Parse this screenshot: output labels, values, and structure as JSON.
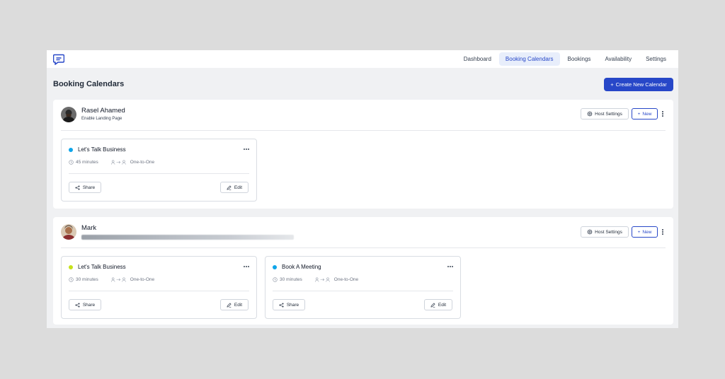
{
  "nav": {
    "items": [
      {
        "label": "Dashboard"
      },
      {
        "label": "Booking Calendars"
      },
      {
        "label": "Bookings"
      },
      {
        "label": "Availability"
      },
      {
        "label": "Settings"
      }
    ],
    "active_index": 1
  },
  "page": {
    "title": "Booking Calendars",
    "create_button": "Create New Calendar"
  },
  "hosts": [
    {
      "name": "Rasel Ahamed",
      "subtitle": "Enable Landing Page",
      "host_settings_label": "Host Settings",
      "new_label": "New",
      "events": [
        {
          "title": "Let's Talk Business",
          "duration": "45 minutes",
          "type": "One-to-One",
          "dot_color": "#0ea5e9",
          "share_label": "Share",
          "edit_label": "Edit"
        }
      ]
    },
    {
      "name": "Mark",
      "subtitle": "",
      "host_settings_label": "Host Settings",
      "new_label": "New",
      "events": [
        {
          "title": "Let's Talk Business",
          "duration": "30 minutes",
          "type": "One-to-One",
          "dot_color": "#c6e11b",
          "share_label": "Share",
          "edit_label": "Edit"
        },
        {
          "title": "Book A Meeting",
          "duration": "30 minutes",
          "type": "One-to-One",
          "dot_color": "#0ea5e9",
          "share_label": "Share",
          "edit_label": "Edit"
        }
      ]
    }
  ],
  "colors": {
    "primary": "#2747c8",
    "nav_active_bg": "#e8eefb",
    "app_bg": "#f0f1f3"
  },
  "icons": {
    "logo": "app-logo-icon",
    "plus": "plus-icon",
    "host_settings": "gear-icon",
    "more": "kebab-icon",
    "clock": "clock-icon",
    "one_to_one": "users-arrow-icon",
    "share": "share-icon",
    "edit": "edit-icon"
  }
}
